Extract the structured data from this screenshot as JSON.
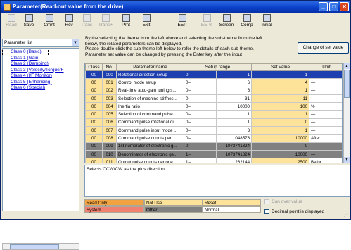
{
  "window": {
    "title": "Parameter(Read-out value from the drive)",
    "buttons": [
      "_",
      "□",
      "✕"
    ]
  },
  "toolbar": {
    "items": [
      {
        "label": "Read",
        "icon": "read-icon",
        "enabled": false
      },
      {
        "label": "Save",
        "icon": "save-icon",
        "enabled": true
      },
      {
        "label": "Cmnt",
        "icon": "comment-icon",
        "enabled": true
      },
      {
        "label": "Rcv",
        "icon": "receive-icon",
        "enabled": true
      },
      {
        "label": "Trans",
        "icon": "transfer-icon",
        "enabled": false
      },
      {
        "label": "Trans+",
        "icon": "transfer-plus-icon",
        "enabled": false
      },
      {
        "label": "Prnt",
        "icon": "print-icon",
        "enabled": true
      },
      {
        "label": "Exit",
        "icon": "exit-icon",
        "enabled": true
      },
      {
        "label": "EEP",
        "icon": "eep-icon",
        "enabled": true
      },
      {
        "label": "EEPs",
        "icon": "eeps-icon",
        "enabled": false
      },
      {
        "label": "Screen",
        "icon": "screen-icon",
        "enabled": true
      },
      {
        "label": "Comp",
        "icon": "compare-icon",
        "enabled": true
      },
      {
        "label": "Initial",
        "icon": "initial-icon",
        "enabled": true
      }
    ]
  },
  "left_panel": {
    "combo_value": "Parameter list",
    "tree": [
      "Class 0 (Basic)",
      "Class 1 (Gain)",
      "Class 2 (Damping)",
      "Class 3 (Velocity/Torque/F",
      "Class 4 (I/F Monitor)",
      "Class 5 (Enhancing)",
      "Class 6 (Special)"
    ]
  },
  "instructions": [
    "By the selecting the theme from the left above,and selecting the sub-theme from the left",
    "below, the related parameters can be displayed.",
    "Please double-click the sub-theme left below to refer the details of each sub-theme.",
    "Parameter set value can be changed by pressing the Enter key after the input"
  ],
  "change_button": "Change of set value",
  "grid": {
    "headers": [
      "Class",
      "No.",
      "Parameter name",
      "Setup range",
      "",
      "Set value",
      "Unit"
    ],
    "rows": [
      {
        "cls": "00",
        "no": "000",
        "name": "Rotational direction setup",
        "min": "0–",
        "max": "1",
        "value": "1",
        "unit": "—",
        "style": "sel"
      },
      {
        "cls": "00",
        "no": "001",
        "name": "Control mode setup",
        "min": "0–",
        "max": "6",
        "value": "4",
        "unit": "—",
        "style": "normal"
      },
      {
        "cls": "00",
        "no": "002",
        "name": "Real-time auto-gain tuning s...",
        "min": "0–",
        "max": "6",
        "value": "1",
        "unit": "—",
        "style": "normal"
      },
      {
        "cls": "00",
        "no": "003",
        "name": "Selection of machine stiffnes...",
        "min": "0–",
        "max": "31",
        "value": "11",
        "unit": "—",
        "style": "normal"
      },
      {
        "cls": "00",
        "no": "004",
        "name": "Inertia ratio",
        "min": "0–",
        "max": "10000",
        "value": "100",
        "unit": "%",
        "style": "normal"
      },
      {
        "cls": "00",
        "no": "005",
        "name": "Selection of command pulse ...",
        "min": "0–",
        "max": "1",
        "value": "1",
        "unit": "—",
        "style": "normal"
      },
      {
        "cls": "00",
        "no": "006",
        "name": "Command pulse rotational di...",
        "min": "0–",
        "max": "1",
        "value": "0",
        "unit": "—",
        "style": "normal"
      },
      {
        "cls": "00",
        "no": "007",
        "name": "Command pulse input mode ...",
        "min": "0–",
        "max": "3",
        "value": "1",
        "unit": "—",
        "style": "normal"
      },
      {
        "cls": "00",
        "no": "008",
        "name": "Command pulse counts per ...",
        "min": "0–",
        "max": "1048576",
        "value": "10000",
        "unit": "After...",
        "style": "normal"
      },
      {
        "cls": "00",
        "no": "009",
        "name": "1st numerator of electronic g...",
        "min": "0–",
        "max": "1073741824",
        "value": "0",
        "unit": "—",
        "style": "gray"
      },
      {
        "cls": "00",
        "no": "010",
        "name": "Denominator of electronic ge...",
        "min": "1–",
        "max": "1073741824",
        "value": "10000",
        "unit": "—",
        "style": "gray"
      },
      {
        "cls": "00",
        "no": "011",
        "name": "Output pulse counts per one ...",
        "min": "1–",
        "max": "262144",
        "value": "2500",
        "unit": "Befor...",
        "style": "normal"
      }
    ]
  },
  "note_text": "Selects CCW/CW as the plus direction.",
  "legend": {
    "read_only": "Read Only",
    "not_use": "Not Use",
    "reset": "Reset",
    "system": "System",
    "other": "Other",
    "normal": "Normal",
    "colors": {
      "read_only": "#f0a340",
      "not_use": "#fde29a",
      "reset": "#fde29a",
      "system": "#f08070",
      "other": "#808080",
      "normal": "#ffffff"
    }
  },
  "checks": {
    "cancel_over": "Can over value",
    "decimal": "Decimal point is displayed"
  }
}
